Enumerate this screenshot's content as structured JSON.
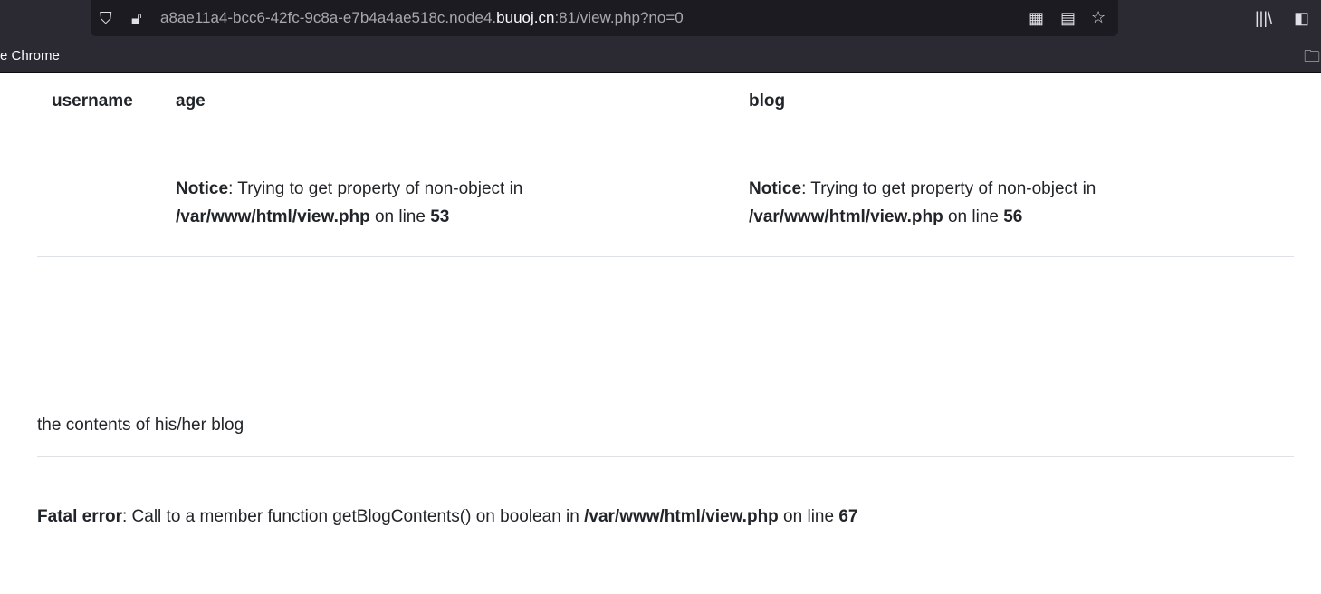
{
  "browser": {
    "url_prefix": "a8ae11a4-bcc6-42fc-9c8a-e7b4a4ae518c.node4.",
    "url_host": "buuoj.cn",
    "url_suffix": ":81/view.php?no=0",
    "bookmark": "e Chrome"
  },
  "table": {
    "headers": [
      "username",
      "age",
      "blog"
    ],
    "age_notice": {
      "label": "Notice",
      "msg": ": Trying to get property of non-object in ",
      "path": "/var/www/html/view.php",
      "online": " on line ",
      "line": "53"
    },
    "blog_notice": {
      "label": "Notice",
      "msg": ": Trying to get property of non-object in ",
      "path": "/var/www/html/view.php",
      "online": " on line ",
      "line": "56"
    }
  },
  "blog_contents": "the contents of his/her blog",
  "fatal": {
    "label": "Fatal error",
    "msg": ": Call to a member function getBlogContents() on boolean in ",
    "path": "/var/www/html/view.php",
    "online": " on line ",
    "line": "67"
  }
}
